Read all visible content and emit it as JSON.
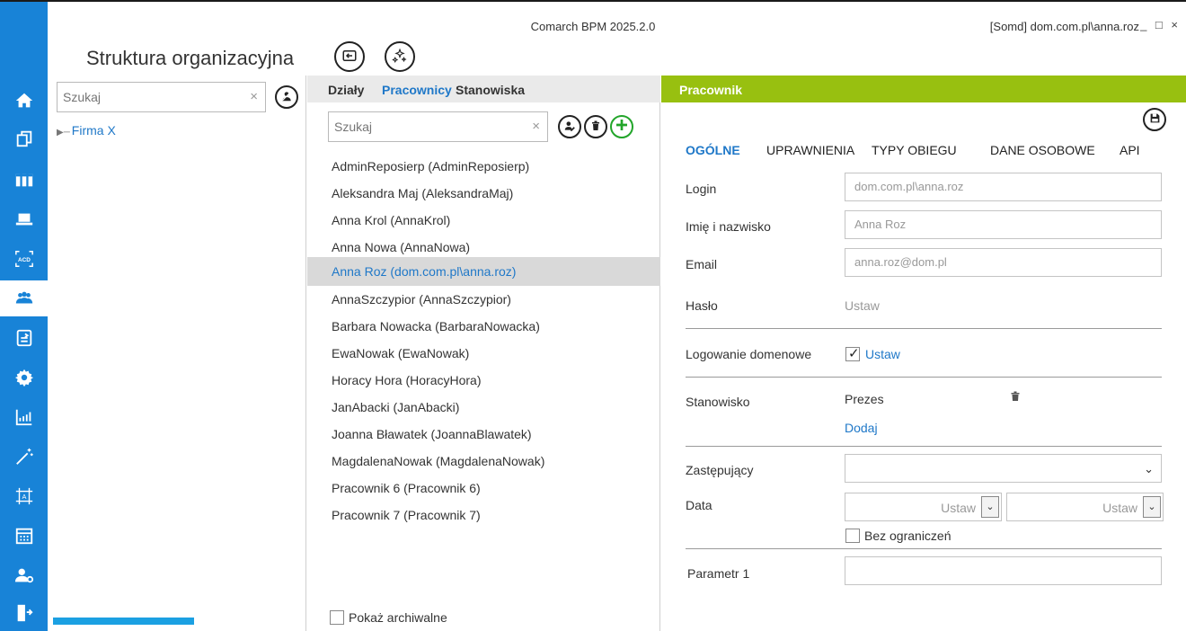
{
  "window": {
    "app_title": "Comarch BPM 2025.2.0",
    "user_info": "[Somd] dom.com.pl\\anna.roz",
    "controls": "_ □ ×"
  },
  "page": {
    "title": "Struktura organizacyjna"
  },
  "rail": {
    "icons": [
      "home-icon",
      "copy-icon",
      "columns-icon",
      "laptop-icon",
      "ocr-acd-icon",
      "people-icon",
      "document-icon",
      "gear-icon",
      "analytics-icon",
      "wand-icon",
      "design-icon",
      "calendar-icon",
      "user-settings-icon",
      "exit-icon"
    ],
    "ocr_label": "ACD",
    "active": "people-icon",
    "colors": {
      "background": "#1883d7",
      "icon": "#ffffff"
    }
  },
  "structure_panel": {
    "search_placeholder": "Szukaj",
    "clear": "×",
    "tree": [
      {
        "label": "Firma X"
      }
    ]
  },
  "employees_panel": {
    "tabs": [
      "Działy",
      "Pracownicy",
      "Stanowiska"
    ],
    "active_tab": "Pracownicy",
    "search_placeholder": "Szukaj",
    "clear": "×",
    "items": [
      "AdminReposierp (AdminReposierp)",
      "Aleksandra Maj (AleksandraMaj)",
      "Anna Krol (AnnaKrol)",
      "Anna Nowa (AnnaNowa)",
      "Anna Roz (dom.com.pl\\anna.roz)",
      "AnnaSzczypior (AnnaSzczypior)",
      "Barbara Nowacka (BarbaraNowacka)",
      "EwaNowak (EwaNowak)",
      "Horacy Hora (HoracyHora)",
      "JanAbacki (JanAbacki)",
      "Joanna Bławatek (JoannaBlawatek)",
      "MagdalenaNowak (MagdalenaNowak)",
      "Pracownik 6 (Pracownik 6)",
      "Pracownik 7 (Pracownik 7)"
    ],
    "selected": "Anna Roz (dom.com.pl\\anna.roz)",
    "show_archived_label": "Pokaż archiwalne",
    "show_archived_checked": false
  },
  "employee_form": {
    "header": "Pracownik",
    "header_color": "#98c010",
    "tabs": [
      "OGÓLNE",
      "UPRAWNIENIA",
      "TYPY OBIEGU",
      "DANE OSOBOWE",
      "API"
    ],
    "active_tab": "OGÓLNE",
    "login_label": "Login",
    "login_value": "dom.com.pl\\anna.roz",
    "name_label": "Imię i nazwisko",
    "name_value": "Anna Roz",
    "email_label": "Email",
    "email_value": "anna.roz@dom.pl",
    "password_label": "Hasło",
    "password_action": "Ustaw",
    "domain_login_label": "Logowanie domenowe",
    "domain_login_checked": true,
    "domain_login_action": "Ustaw",
    "position_label": "Stanowisko",
    "position_value": "Prezes",
    "position_add": "Dodaj",
    "substitute_label": "Zastępujący",
    "substitute_value": "",
    "date_label": "Data",
    "date_from": "Ustaw",
    "date_to": "Ustaw",
    "no_limit_label": "Bez ograniczeń",
    "no_limit_checked": false,
    "param1_label": "Parametr 1",
    "param1_value": ""
  },
  "progress": {
    "value": 0.14
  }
}
